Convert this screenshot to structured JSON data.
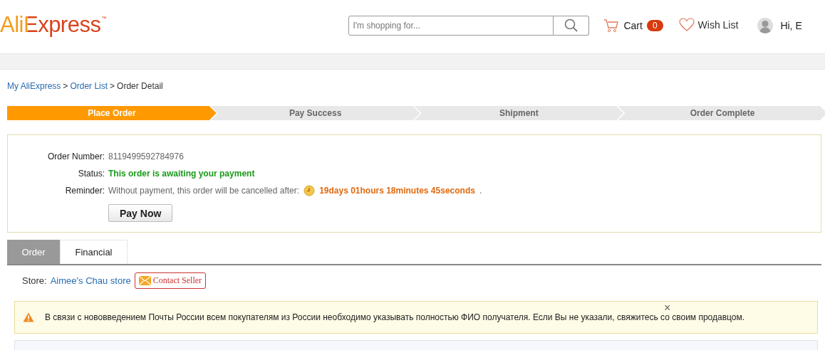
{
  "header": {
    "logo": "AliExpress",
    "logo_mark": "™",
    "search": {
      "placeholder": "I'm shopping for..."
    },
    "cart": {
      "label": "Cart",
      "count": "0"
    },
    "wish_list": "Wish List",
    "greeting": "Hi, E"
  },
  "breadcrumb": [
    {
      "label": "My AliExpress",
      "kind": "link"
    },
    {
      "label": ">",
      "kind": "separator"
    },
    {
      "label": "Order List",
      "kind": "link"
    },
    {
      "label": ">",
      "kind": "separator"
    },
    {
      "label": "Order Detail",
      "kind": "current"
    }
  ],
  "steps": [
    {
      "label": "Place Order",
      "selected": true
    },
    {
      "label": "Pay Success",
      "selected": false
    },
    {
      "label": "Shipment",
      "selected": false
    },
    {
      "label": "Order Complete",
      "selected": false
    }
  ],
  "order": {
    "number_label": "Order Number:",
    "number": "8119499592784976",
    "status_label": "Status:",
    "status": "This order is awaiting your payment",
    "reminder_label": "Reminder:",
    "reminder": "Without payment, this order will be cancelled after:",
    "countdown": "19days 01hours 18minutes 45seconds",
    "countdown_end": ".",
    "pay_button": "Pay Now"
  },
  "tabs": [
    {
      "label": "Order",
      "selected": true
    },
    {
      "label": "Financial",
      "selected": false
    }
  ],
  "store": {
    "label": "Store:",
    "name": "Aimee's Chau store",
    "contact_button": "Contact Seller"
  },
  "notice": {
    "text": "В связи с нововведением Почты России всем покупателям из России необходимо указывать полностью ФИО получателя. Если Вы не указали, свяжитесь со своим продавцом.",
    "close": "×"
  }
}
